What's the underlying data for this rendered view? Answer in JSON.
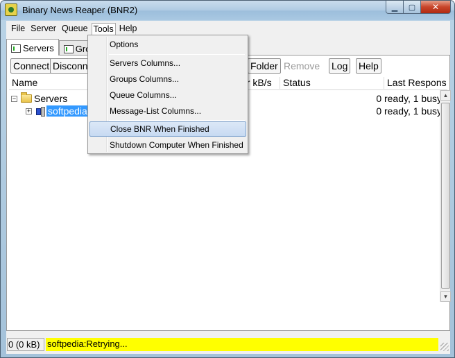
{
  "window": {
    "title": "Binary News Reaper (BNR2)",
    "controls": {
      "minimize": "▁",
      "maximize": "▢",
      "close": "✕"
    }
  },
  "menubar": {
    "items": [
      "File",
      "Server",
      "Queue",
      "Tools",
      "Help"
    ]
  },
  "tabs": [
    "Servers",
    "Gro"
  ],
  "toolbar": {
    "connect": "Connect",
    "disconnect": "Disconn",
    "folder": "Folder",
    "remove": "Remove",
    "log": "Log",
    "help": "Help"
  },
  "columns": {
    "name": "Name",
    "kbs": "ur kB/s",
    "status": "Status",
    "last_response": "Last Respons"
  },
  "tree": {
    "root_label": "Servers",
    "root_expander": "⊟",
    "child_label": "softpedia",
    "child_expander": "+",
    "rows_right": [
      "0 ready, 1 busy",
      "0 ready, 1 busy"
    ]
  },
  "tools_menu": {
    "items": [
      "Options",
      "Servers Columns...",
      "Groups Columns...",
      "Queue Columns...",
      "Message-List Columns...",
      "Close BNR When Finished",
      "Shutdown Computer When Finished"
    ],
    "highlighted_index": 5
  },
  "statusbar": {
    "transfer": "0 (0 kB)",
    "message": "softpedia:Retrying...",
    "message_bg": "#ffff00"
  },
  "scroll": {
    "up": "▲",
    "down": "▼",
    "left": "◀",
    "right": "▶"
  }
}
